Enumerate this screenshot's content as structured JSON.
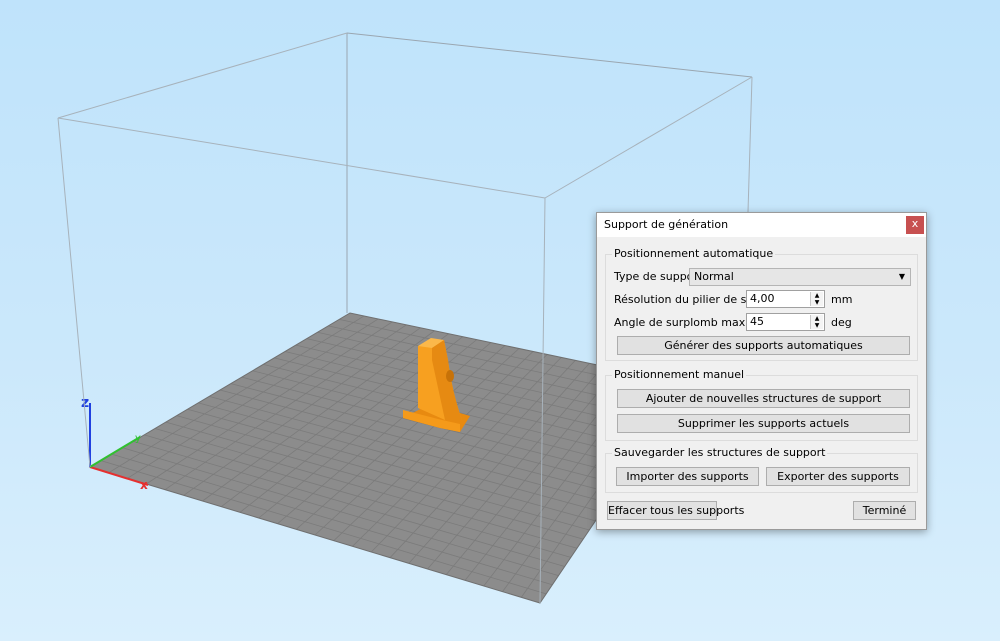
{
  "dialog": {
    "title": "Support de génération",
    "close_label": "x",
    "auto_group": {
      "title": "Positionnement automatique",
      "type_label": "Type de support",
      "type_value": "Normal",
      "resolution_label": "Résolution du pilier de support",
      "resolution_value": "4,00",
      "resolution_unit": "mm",
      "angle_label": "Angle de surplomb maximal",
      "angle_value": "45",
      "angle_unit": "deg",
      "generate_button": "Générer des supports automatiques"
    },
    "manual_group": {
      "title": "Positionnement manuel",
      "add_button": "Ajouter de nouvelles structures de support",
      "remove_button": "Supprimer les supports actuels"
    },
    "save_group": {
      "title": "Sauvegarder les structures de support",
      "import_button": "Importer des supports",
      "export_button": "Exporter des supports"
    },
    "clear_all_button": "Effacer tous les supports",
    "done_button": "Terminé"
  },
  "colors": {
    "model": "#f7a020",
    "bed": "#8c8c8c",
    "axis_x": "#e53030",
    "axis_y": "#30c030",
    "axis_z": "#2040e0"
  }
}
